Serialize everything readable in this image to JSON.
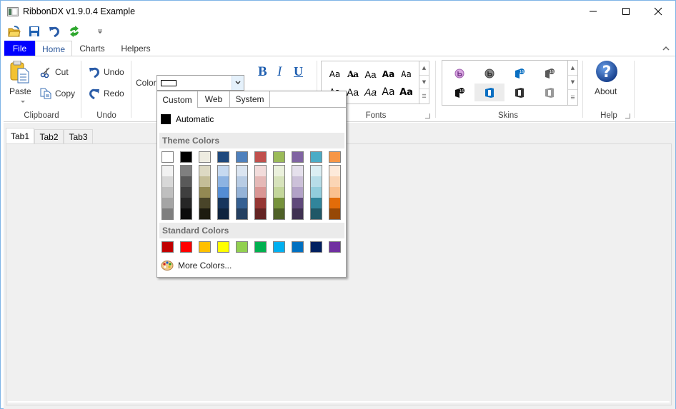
{
  "window": {
    "title": "RibbonDX v1.9.0.4 Example",
    "minimize_icon": "minimize-icon",
    "maximize_icon": "maximize-icon",
    "close_icon": "close-icon"
  },
  "quick_access": [
    {
      "name": "open-icon"
    },
    {
      "name": "save-icon"
    },
    {
      "name": "undo-icon"
    },
    {
      "name": "refresh-icon"
    },
    {
      "name": "customize-qat-icon"
    }
  ],
  "ribbon_tabs": [
    {
      "label": "File"
    },
    {
      "label": "Home"
    },
    {
      "label": "Charts"
    },
    {
      "label": "Helpers"
    }
  ],
  "groups": {
    "clipboard": {
      "label": "Clipboard",
      "paste": "Paste",
      "cut": "Cut",
      "copy": "Copy"
    },
    "undo": {
      "label": "Undo",
      "undo": "Undo",
      "redo": "Redo"
    },
    "format": {
      "color_label": "Color",
      "bold": "B",
      "italic": "I",
      "underline": "U"
    },
    "fonts": {
      "label": "Fonts",
      "items": [
        "Aa",
        "Aa",
        "Aa",
        "Aa",
        "Aa",
        "Aa",
        "Aa",
        "Aa",
        "Aa",
        "Aa"
      ]
    },
    "skins": {
      "label": "Skins",
      "items": [
        {
          "name": "skin-purple-b",
          "color": "#b06fc0"
        },
        {
          "name": "skin-gray-b",
          "color": "#606060"
        },
        {
          "name": "skin-office2016-blue",
          "color": "#0a6fc2"
        },
        {
          "name": "skin-office2016-gray",
          "color": "#5a5a5a"
        },
        {
          "name": "skin-office2016-black",
          "color": "#111111"
        },
        {
          "name": "skin-office-blue",
          "color": "#0a6fc2",
          "selected": true
        },
        {
          "name": "skin-office-dark",
          "color": "#333333"
        },
        {
          "name": "skin-office-light",
          "color": "#999999"
        }
      ]
    },
    "help": {
      "label": "Help",
      "about": "About"
    }
  },
  "color_popup": {
    "tabs": [
      "Custom",
      "Web",
      "System"
    ],
    "automatic_label": "Automatic",
    "theme_header": "Theme Colors",
    "theme_top": [
      "#ffffff",
      "#000000",
      "#eeece1",
      "#1f497d",
      "#4f81bd",
      "#c0504d",
      "#9bbb59",
      "#8064a2",
      "#4bacc6",
      "#f79646"
    ],
    "theme_shades": [
      [
        "#f2f2f2",
        "#d8d8d8",
        "#bfbfbf",
        "#a5a5a5",
        "#7f7f7f"
      ],
      [
        "#7f7f7f",
        "#595959",
        "#3f3f3f",
        "#262626",
        "#0c0c0c"
      ],
      [
        "#ddd9c3",
        "#c4bd97",
        "#938953",
        "#494429",
        "#1d1b10"
      ],
      [
        "#c6d9f0",
        "#8db3e2",
        "#548dd4",
        "#17365d",
        "#0f243e"
      ],
      [
        "#dbe5f1",
        "#b8cce4",
        "#95b3d7",
        "#366092",
        "#244061"
      ],
      [
        "#f2dcdb",
        "#e5b9b7",
        "#d99694",
        "#953734",
        "#632423"
      ],
      [
        "#ebf1dd",
        "#d7e3bc",
        "#c3d69b",
        "#76923c",
        "#4f6128"
      ],
      [
        "#e5e0ec",
        "#ccc1d9",
        "#b2a2c7",
        "#5f497a",
        "#3f3151"
      ],
      [
        "#dbeef3",
        "#b7dde8",
        "#92cddc",
        "#31859b",
        "#205867"
      ],
      [
        "#fdeada",
        "#fbd5b5",
        "#fac08f",
        "#e36c09",
        "#974806"
      ]
    ],
    "standard_header": "Standard Colors",
    "standard": [
      "#c00000",
      "#ff0000",
      "#ffc000",
      "#ffff00",
      "#92d050",
      "#00b050",
      "#00b0f0",
      "#0070c0",
      "#002060",
      "#7030a0"
    ],
    "more_colors": "More Colors..."
  },
  "content_tabs": [
    {
      "label": "Tab1"
    },
    {
      "label": "Tab2"
    },
    {
      "label": "Tab3"
    }
  ]
}
